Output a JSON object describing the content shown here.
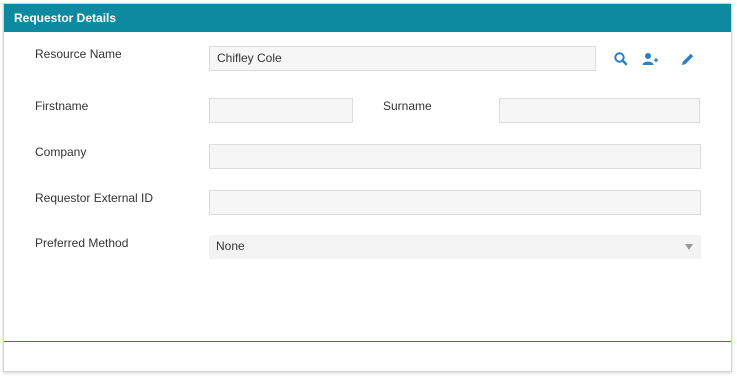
{
  "panel": {
    "title": "Requestor Details"
  },
  "form": {
    "resource_name": {
      "label": "Resource Name",
      "value": "Chifley Cole"
    },
    "firstname": {
      "label": "Firstname",
      "value": ""
    },
    "surname": {
      "label": "Surname",
      "value": ""
    },
    "company": {
      "label": "Company",
      "value": ""
    },
    "requestor_external_id": {
      "label": "Requestor External ID",
      "value": ""
    },
    "preferred_method": {
      "label": "Preferred Method",
      "value": "None"
    }
  },
  "icons": {
    "search": "search-icon",
    "add_user": "add-user-icon",
    "edit": "pencil-icon"
  },
  "colors": {
    "header": "#0d8aa0",
    "icon_blue": "#2c7fc0",
    "footer_line": "#1a7fa8"
  }
}
